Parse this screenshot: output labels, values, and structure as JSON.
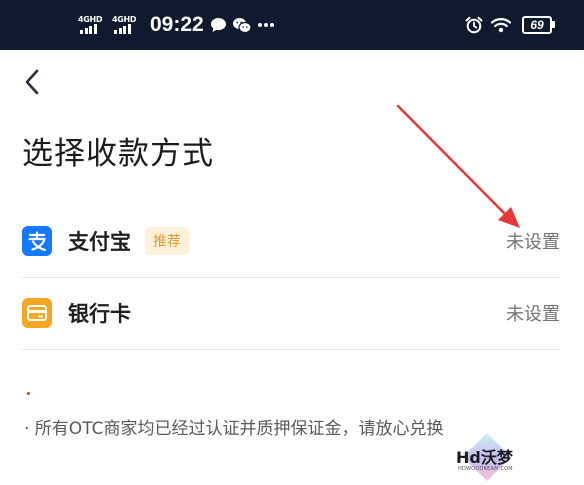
{
  "status_bar": {
    "network_1": "4GHD",
    "network_2": "4GHD",
    "time": "09:22",
    "notification_icons": [
      "chat-bubble-icon",
      "wechat-icon",
      "more-dots-icon"
    ],
    "right_icons": [
      "alarm-clock-icon",
      "wifi-icon"
    ],
    "battery": "69"
  },
  "header": {
    "back_icon": "chevron-left-icon",
    "title": "选择收款方式"
  },
  "methods": [
    {
      "icon": "alipay-icon",
      "name": "支付宝",
      "badge": "推荐",
      "status": "未设置"
    },
    {
      "icon": "bank-card-icon",
      "name": "银行卡",
      "status": "未设置"
    }
  ],
  "notice": "· 所有OTC商家均已经过认证并质押保证金，请放心兑换",
  "watermark": {
    "text": "Hd沃梦",
    "subtext": "HDWOODREAM.COM"
  },
  "colors": {
    "status_bar_bg": "#0f1a2e",
    "alipay_blue": "#1677ff",
    "bank_orange": "#f5a623",
    "badge_bg": "#fdf1dc",
    "badge_text": "#e59a2a",
    "annotation_arrow": "#e53935"
  }
}
